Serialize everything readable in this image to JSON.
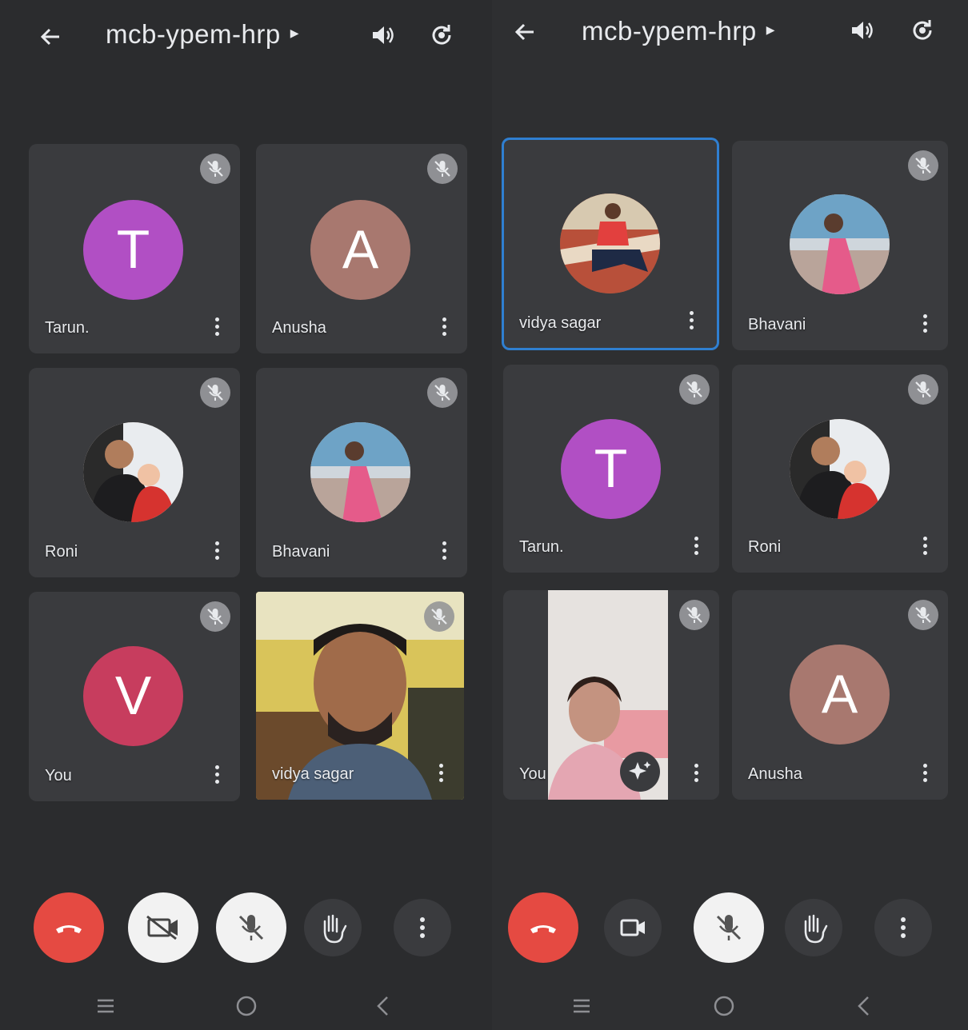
{
  "meeting_code": "mcb-ypem-hrp",
  "colors": {
    "background": "#2b2c2e",
    "tile": "#3a3b3e",
    "active_border": "#2f7fd1",
    "hangup": "#e54a42",
    "avatar_purple": "#b14fc4",
    "avatar_brown": "#a8786f",
    "avatar_red": "#c73d5e"
  },
  "left_screen": {
    "tiles": [
      {
        "name": "Tarun.",
        "avatar_letter": "T",
        "muted": true
      },
      {
        "name": "Anusha",
        "avatar_letter": "A",
        "muted": true
      },
      {
        "name": "Roni",
        "avatar_type": "photo",
        "muted": true
      },
      {
        "name": "Bhavani",
        "avatar_type": "photo",
        "muted": true
      },
      {
        "name": "You",
        "avatar_letter": "V",
        "muted": true
      },
      {
        "name": "vidya sagar",
        "avatar_type": "live-video",
        "muted": true
      }
    ],
    "controls": [
      "end-call",
      "camera-off",
      "mic-off",
      "raise-hand",
      "more-options"
    ]
  },
  "right_screen": {
    "tiles": [
      {
        "name": "vidya sagar",
        "avatar_type": "photo",
        "active_speaker": true
      },
      {
        "name": "Bhavani",
        "avatar_type": "photo",
        "muted": true
      },
      {
        "name": "Tarun.",
        "avatar_letter": "T",
        "muted": true
      },
      {
        "name": "Roni",
        "avatar_type": "photo",
        "muted": true
      },
      {
        "name": "You",
        "avatar_type": "live-video",
        "muted": true
      },
      {
        "name": "Anusha",
        "avatar_letter": "A",
        "muted": true
      }
    ],
    "controls": [
      "end-call",
      "camera-on",
      "mic-off",
      "raise-hand",
      "more-options"
    ]
  }
}
